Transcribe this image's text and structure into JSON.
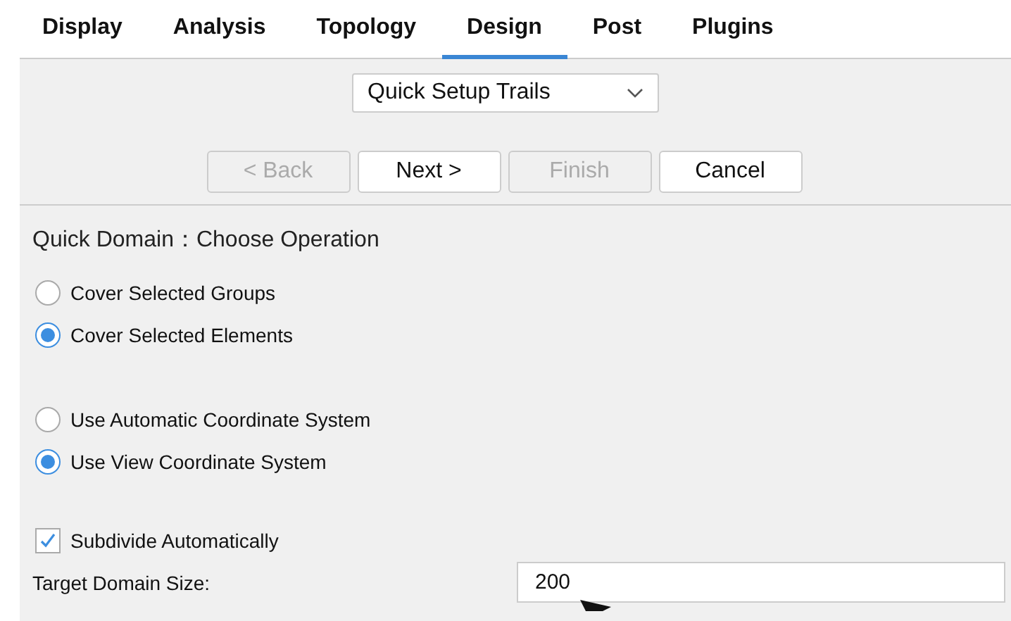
{
  "tabs": [
    {
      "label": "Display",
      "selected": false
    },
    {
      "label": "Analysis",
      "selected": false
    },
    {
      "label": "Topology",
      "selected": false
    },
    {
      "label": "Design",
      "selected": true
    },
    {
      "label": "Post",
      "selected": false
    },
    {
      "label": "Plugins",
      "selected": false
    }
  ],
  "dropdown": {
    "value": "Quick Setup Trails"
  },
  "buttons": [
    {
      "label": "< Back",
      "disabled": true
    },
    {
      "label": "Next >",
      "disabled": false
    },
    {
      "label": "Finish",
      "disabled": true
    },
    {
      "label": "Cancel",
      "disabled": false
    }
  ],
  "heading": "Quick Domain：Choose Operation",
  "radio_groups": [
    [
      {
        "label": "Cover Selected Groups",
        "selected": false
      },
      {
        "label": "Cover Selected Elements",
        "selected": true
      }
    ],
    [
      {
        "label": "Use Automatic Coordinate System",
        "selected": false
      },
      {
        "label": "Use View Coordinate System",
        "selected": true
      }
    ]
  ],
  "subdivide": {
    "label": "Subdivide Automatically",
    "checked": true
  },
  "target_size": {
    "label": "Target Domain Size:",
    "value": "200"
  }
}
